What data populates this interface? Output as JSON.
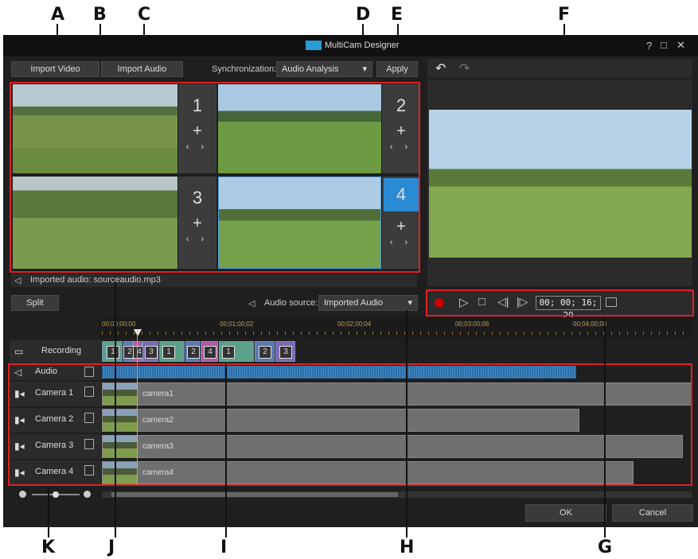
{
  "callouts": [
    "A",
    "B",
    "C",
    "D",
    "E",
    "F",
    "G",
    "H",
    "I",
    "J",
    "K"
  ],
  "window": {
    "title": "MultiCam Designer",
    "help": "?",
    "maximize": "□",
    "close": "✕"
  },
  "toolbar": {
    "import_video": "Import Video",
    "import_audio": "Import Audio",
    "sync_label": "Synchronization:",
    "sync_value": "Audio Analysis",
    "apply": "Apply"
  },
  "cameras": [
    {
      "number": "1",
      "plus": "+",
      "arrows": "‹ ›"
    },
    {
      "number": "2",
      "plus": "+",
      "arrows": "‹ ›"
    },
    {
      "number": "3",
      "plus": "+",
      "arrows": "‹ ›"
    },
    {
      "number": "4",
      "plus": "+",
      "arrows": "‹ ›",
      "active": true
    }
  ],
  "imported_audio": "Imported audio: sourceaudio.mp3",
  "split": "Split",
  "audio_source": {
    "label": "Audio source:",
    "value": "Imported Audio"
  },
  "preview": {
    "undo": "↶",
    "redo": "↷",
    "timecode": "00; 00; 16; 29"
  },
  "ruler": [
    "00;00;00;00",
    "00;01;00;02",
    "00;02;00;04",
    "00;03;00;06",
    "00;04;00;08"
  ],
  "tracks": [
    {
      "name": "Recording"
    },
    {
      "name": "Audio"
    },
    {
      "name": "Camera 1",
      "clip": "camera1"
    },
    {
      "name": "Camera 2",
      "clip": "camera2"
    },
    {
      "name": "Camera 3",
      "clip": "camera3"
    },
    {
      "name": "Camera 4",
      "clip": "camera4"
    }
  ],
  "recording_segments": [
    "1",
    "2",
    "4",
    "3",
    "1",
    "2",
    "4",
    "1",
    "2",
    "3"
  ],
  "footer": {
    "ok": "OK",
    "cancel": "Cancel"
  },
  "colors": {
    "highlight": "#e02020",
    "active_cam": "#2a8ad4"
  }
}
